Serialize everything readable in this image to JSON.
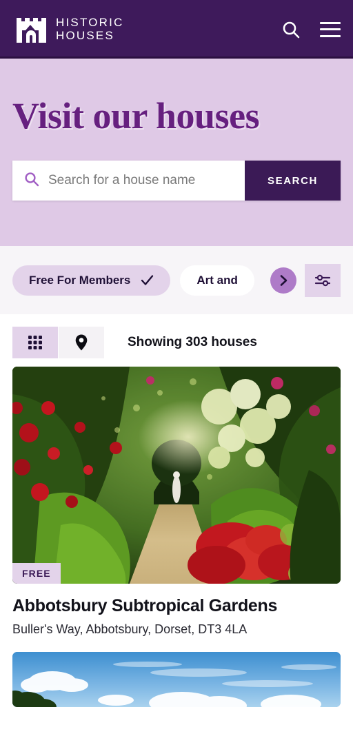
{
  "header": {
    "brand_line1": "HISTORIC",
    "brand_line2": "HOUSES",
    "logo_icon": "castle-logo-icon",
    "search_icon": "search-icon",
    "menu_icon": "hamburger-menu-icon",
    "bg_color": "#3E1A5B"
  },
  "hero": {
    "title": "Visit our houses",
    "title_color": "#66207F",
    "bg_color": "#DFC9E6",
    "search": {
      "value": "",
      "placeholder": "Search for a house name",
      "icon": "search-icon",
      "button_label": "SEARCH",
      "button_color": "#3B1A56"
    }
  },
  "filters": {
    "chips": [
      {
        "label": "Free For Members",
        "selected": true,
        "icon": "check-icon"
      },
      {
        "label": "Art and",
        "selected": false,
        "icon": ""
      }
    ],
    "next_icon": "chevron-right-icon",
    "next_color": "#AE7BC8",
    "filter_button_icon": "sliders-filter-icon",
    "selected_chip_color": "#E3D3EA"
  },
  "results": {
    "views": [
      {
        "name": "grid",
        "icon": "grid-view-icon",
        "active": true
      },
      {
        "name": "map",
        "icon": "map-pin-icon",
        "active": false
      }
    ],
    "count_text": "Showing 303 houses"
  },
  "listings": [
    {
      "badge": "FREE",
      "title": "Abbotsbury Subtropical Gardens",
      "address": "Buller's Way, Abbotsbury, Dorset, DT3 4LA",
      "image_alt": "garden-path-photo"
    },
    {
      "badge": "",
      "title": "",
      "address": "",
      "image_alt": "blue-sky-photo"
    }
  ]
}
